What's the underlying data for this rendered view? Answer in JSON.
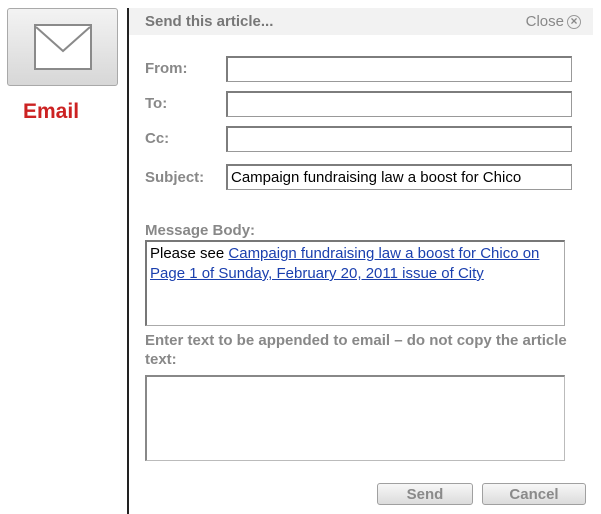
{
  "widget": {
    "icon": "envelope-icon",
    "label": "Email",
    "label_color": "#cc2222"
  },
  "dialog": {
    "title": "Send this article...",
    "close_label": "Close",
    "close_icon": "close-circle-icon",
    "close_glyph": "×",
    "fields": {
      "from_label": "From:",
      "from_value": "",
      "to_label": "To:",
      "to_value": "",
      "cc_label": "Cc:",
      "cc_value": "",
      "subject_label": "Subject:",
      "subject_value": "Campaign fundraising law a boost for Chico"
    },
    "message_body": {
      "label": "Message Body:",
      "prefix": "Please see ",
      "link_text": "Campaign fundraising law a boost for Chico on Page 1 of Sunday, February 20, 2011 issue of City"
    },
    "append": {
      "label": "Enter text to be appended to email – do not copy the article text:",
      "value": ""
    },
    "buttons": {
      "send": "Send",
      "cancel": "Cancel"
    }
  }
}
